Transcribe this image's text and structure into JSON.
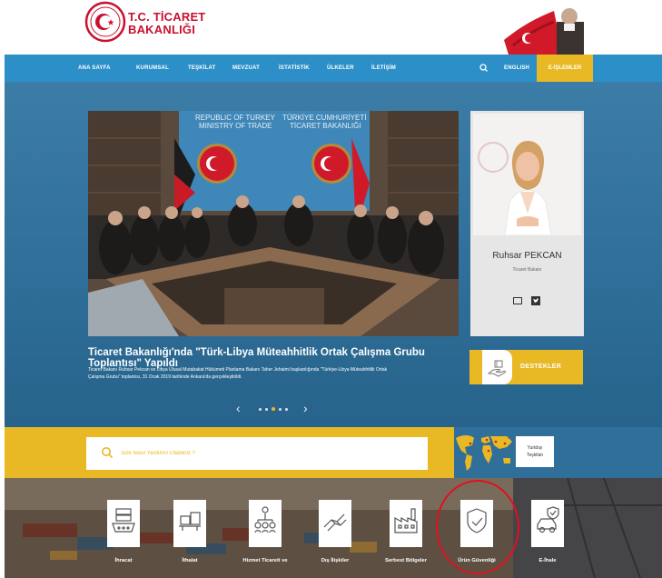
{
  "header": {
    "logo_line1": "T.C. TİCARET",
    "logo_line2": "BAKANLIĞI"
  },
  "nav": {
    "items": [
      "ANA SAYFA",
      "KURUMSAL",
      "TEŞKİLAT",
      "MEVZUAT",
      "İSTATİSTİK",
      "ÜLKELER",
      "İLETİŞİM"
    ],
    "english": "ENGLISH",
    "eislemler": "E-İŞLEMLER"
  },
  "news": {
    "photo_sign_left": "REPUBLIC OF TURKEY\nMINISTRY OF TRADE",
    "photo_sign_right": "TÜRKİYE CUMHURİYETİ\nTİCARET BAKANLIĞI",
    "headline": "Ticaret Bakanlığı'nda \"Türk-Libya Müteahhitlik Ortak Çalışma Grubu Toplantısı\" Yapıldı",
    "summary": "Ticaret Bakanı Ruhsar Pekcan ve Libya Ulusal Mutabakat Hükümeti Planlama Bakanı Taher Jehaimi başkanlığında \"Türkiye-Libya Müteahhitlik Ortak Çalışma Grubu\" toplantısı, 31 Ocak 2019 tarihinde Ankara'da gerçekleştirildi.",
    "carousel_prev": "‹",
    "carousel_next": "›"
  },
  "minister": {
    "name": "Ruhsar PEKCAN",
    "title": "Ticaret Bakanı"
  },
  "destekler": {
    "label": "DESTEKLER"
  },
  "search": {
    "placeholder": "Size Nasıl Yardımcı Olabiliriz ?"
  },
  "yurtdisi": {
    "line1": "Yurtdışı",
    "line2": "Teşkilatı"
  },
  "services": [
    {
      "label": "İhracat"
    },
    {
      "label": "İthalat"
    },
    {
      "label": "Hizmet Ticareti ve"
    },
    {
      "label": "Dış İlişkiler"
    },
    {
      "label": "Serbest Bölgeler"
    },
    {
      "label": "Ürün Güvenliği"
    },
    {
      "label": "E-İhale"
    }
  ],
  "colors": {
    "nav_blue": "#2d8fc7",
    "accent_yellow": "#e9b825",
    "brand_red": "#c8102e",
    "highlight_red": "#e0101e"
  }
}
